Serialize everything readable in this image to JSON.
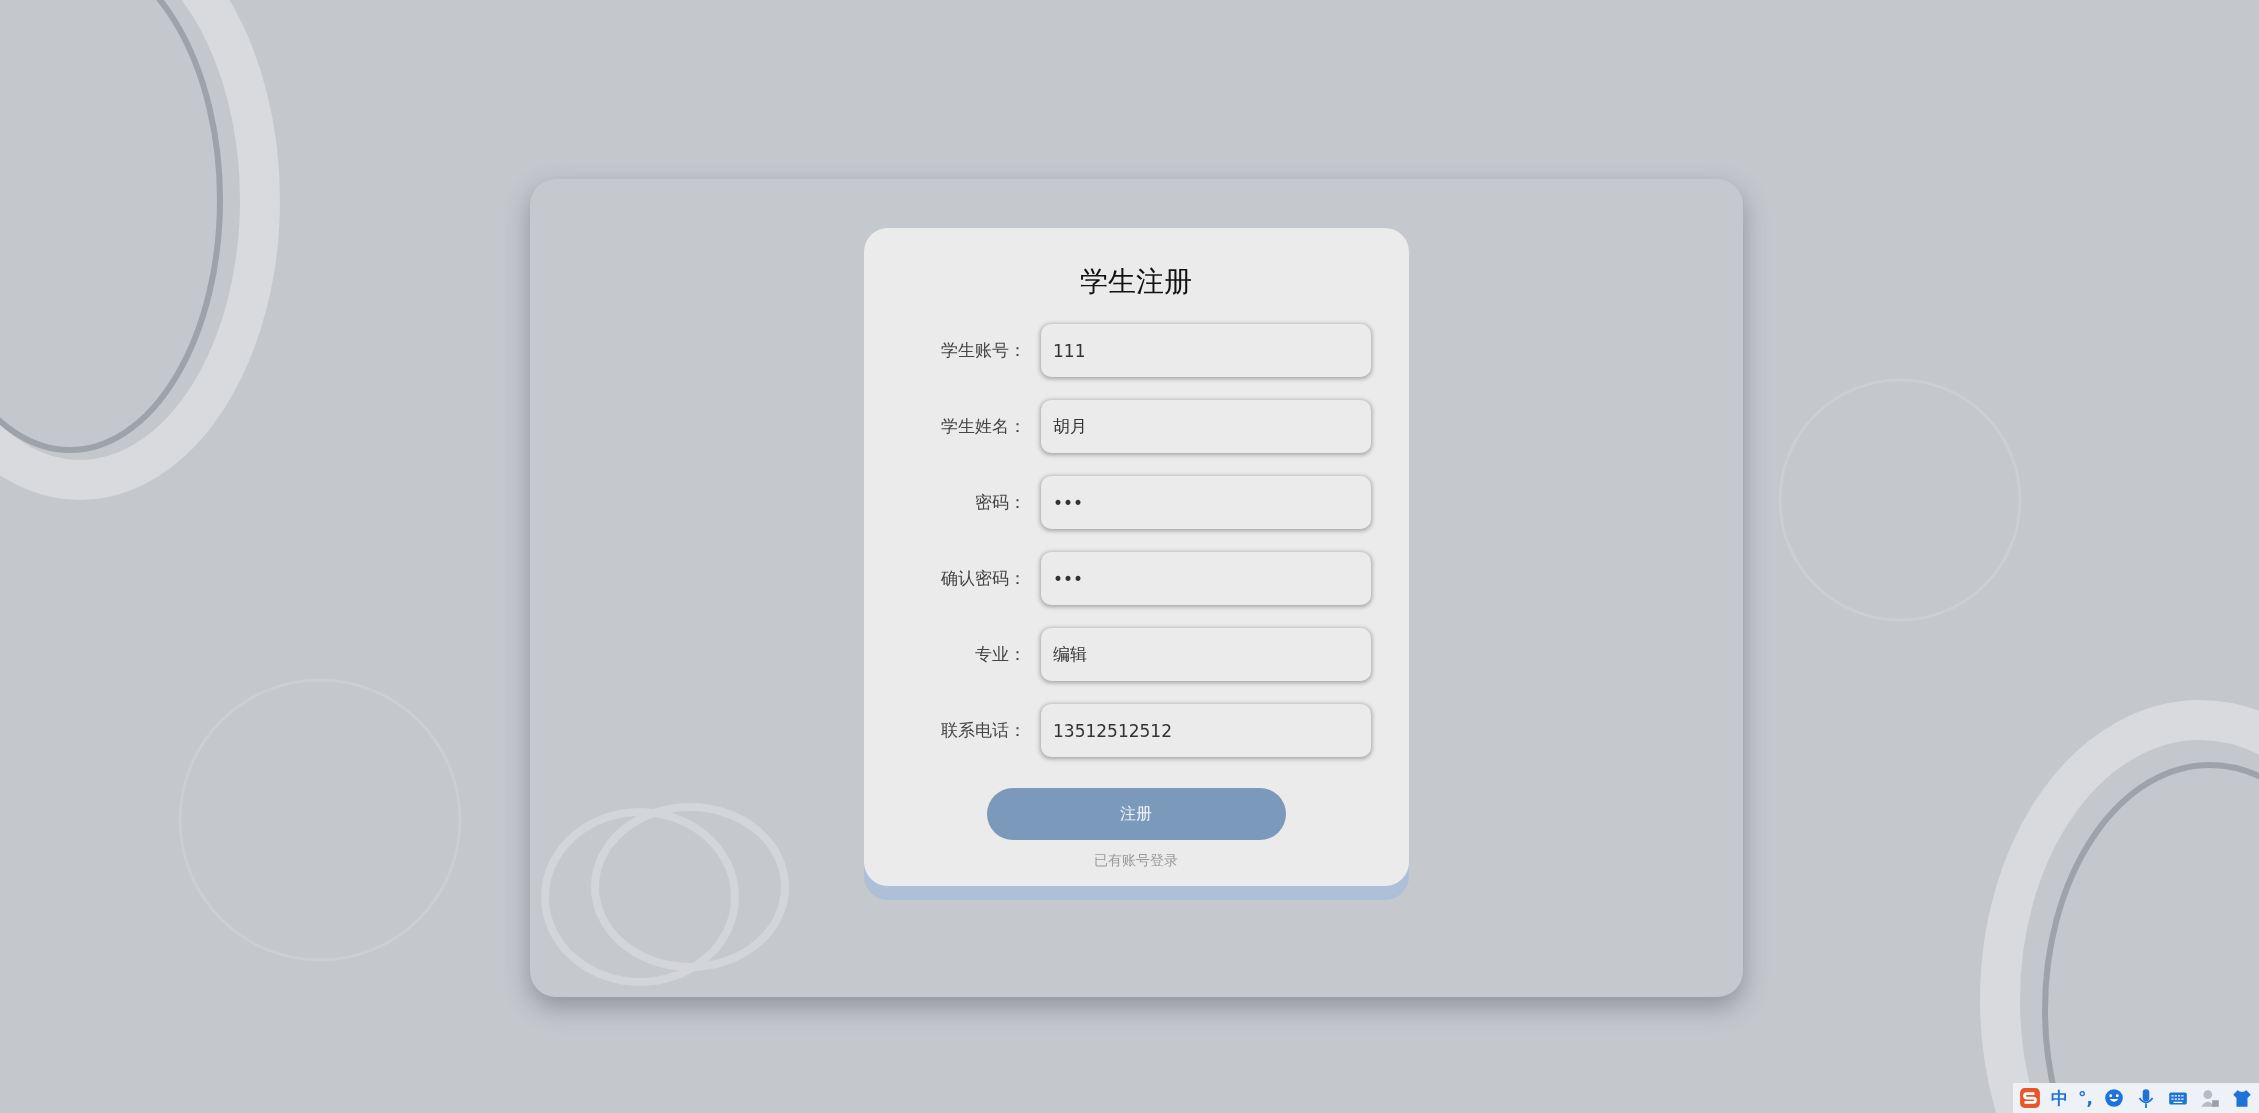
{
  "form": {
    "title": "学生注册",
    "fields": [
      {
        "label": "学生账号：",
        "value": "111"
      },
      {
        "label": "学生姓名：",
        "value": "胡月"
      },
      {
        "label": "密码：",
        "value": "•••"
      },
      {
        "label": "确认密码：",
        "value": "•••"
      },
      {
        "label": "专业：",
        "value": "编辑"
      },
      {
        "label": "联系电话：",
        "value": "13512512512"
      }
    ],
    "submit_button": "注册",
    "login_link": "已有账号登录"
  },
  "ime_toolbar": {
    "mode": "中",
    "punctuation": "°,"
  }
}
